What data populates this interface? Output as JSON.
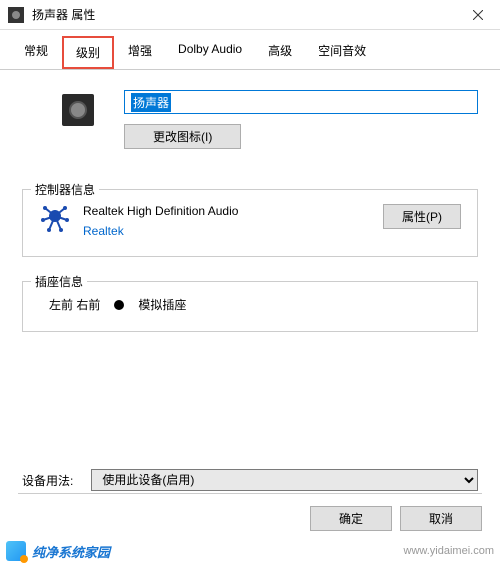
{
  "window": {
    "title": "扬声器 属性"
  },
  "tabs": [
    "常规",
    "级别",
    "增强",
    "Dolby Audio",
    "高级",
    "空间音效"
  ],
  "device": {
    "name": "扬声器",
    "change_icon_label": "更改图标(I)"
  },
  "controller": {
    "legend": "控制器信息",
    "name": "Realtek High Definition Audio",
    "vendor": "Realtek",
    "props_label": "属性(P)"
  },
  "jack": {
    "legend": "插座信息",
    "location": "左前 右前",
    "type": "模拟插座"
  },
  "usage": {
    "label": "设备用法:",
    "value": "使用此设备(启用)"
  },
  "buttons": {
    "ok": "确定",
    "cancel": "取消"
  },
  "watermark": {
    "brand": "纯净系统家园",
    "url": "www.yidaimei.com"
  }
}
